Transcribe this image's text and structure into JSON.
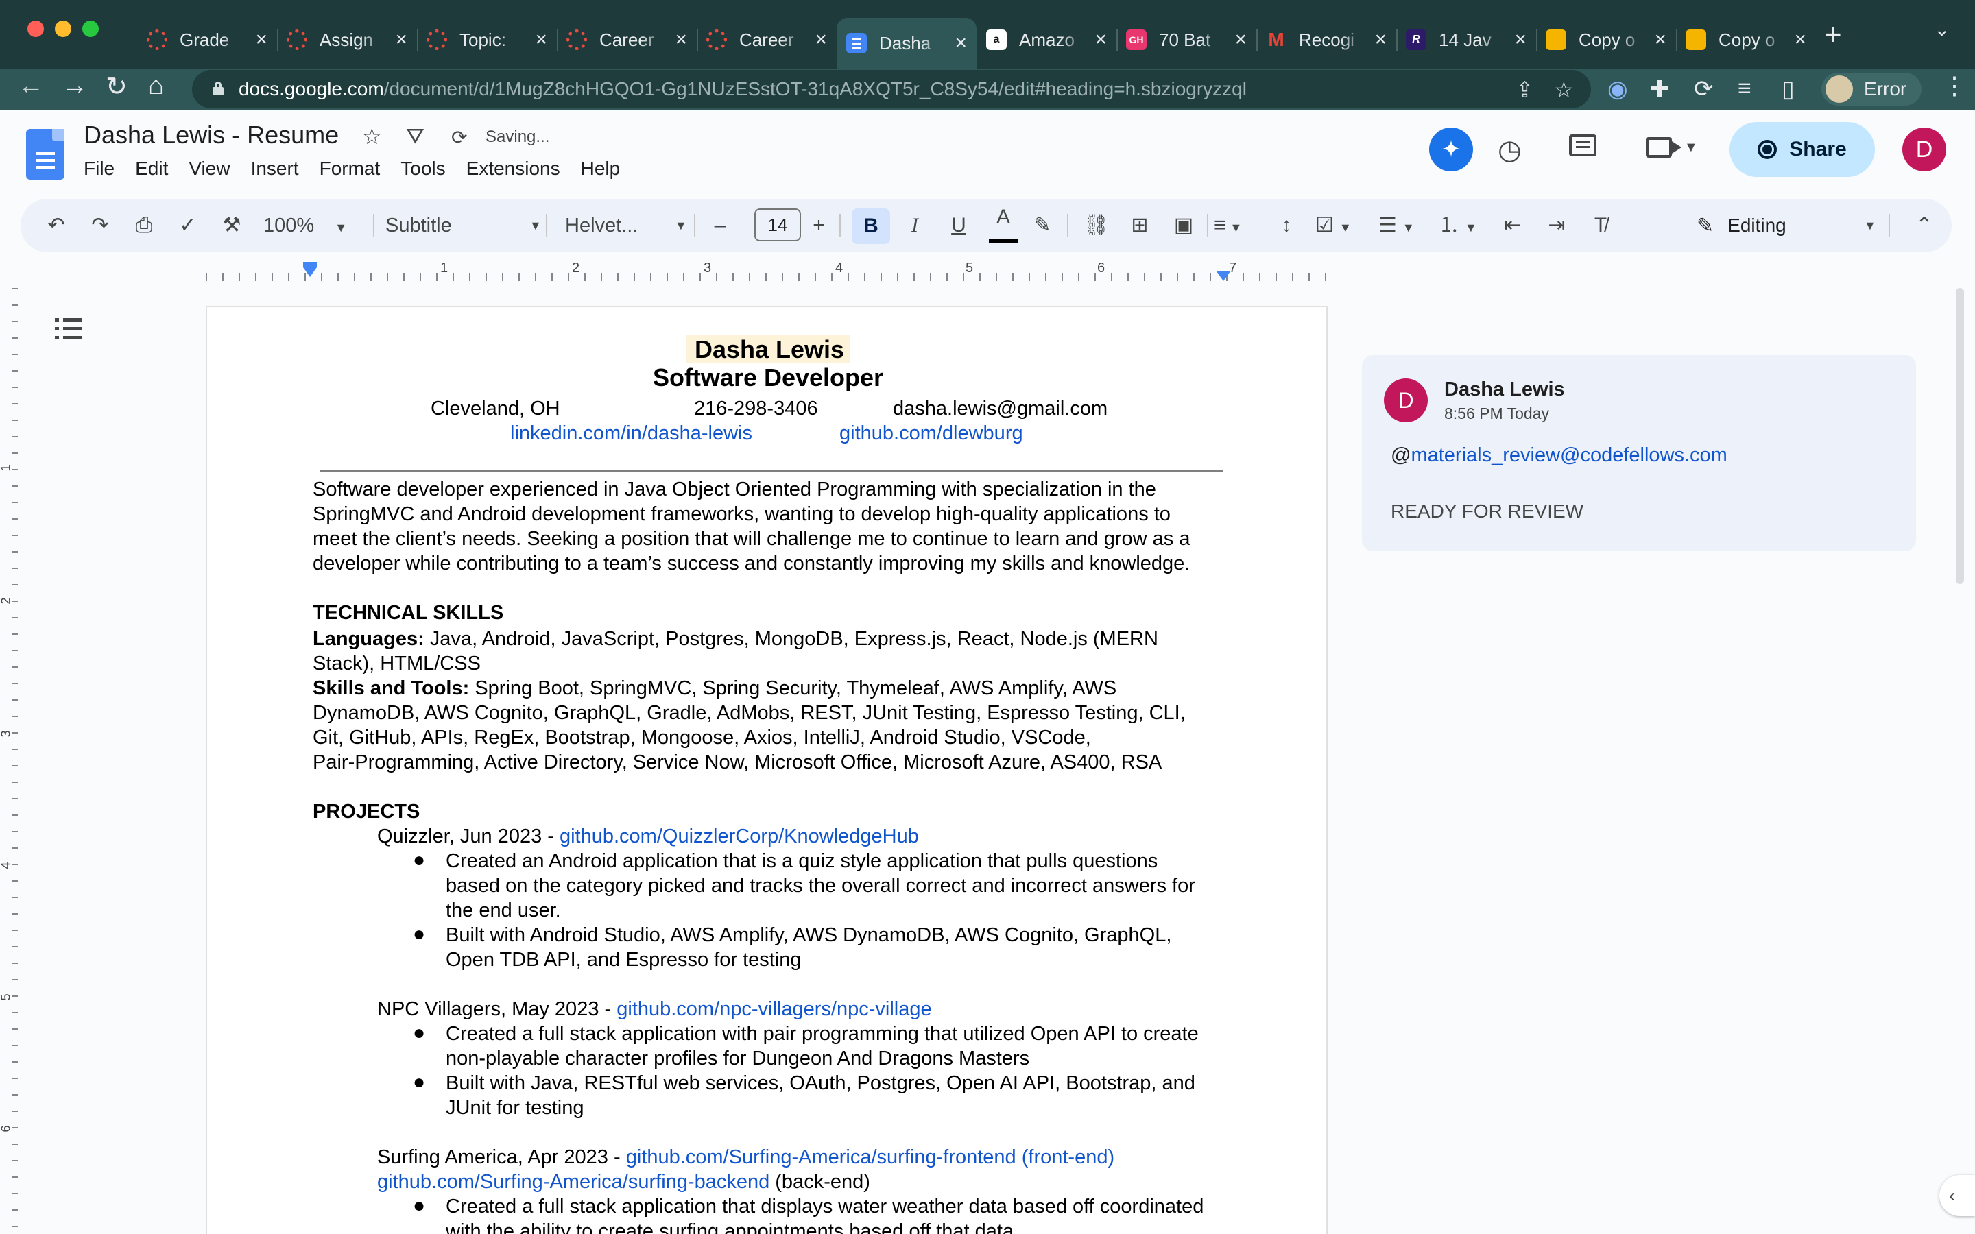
{
  "browser": {
    "tabs": [
      {
        "title": "Grade",
        "icon": "ring"
      },
      {
        "title": "Assign",
        "icon": "ring"
      },
      {
        "title": "Topic:",
        "icon": "ring"
      },
      {
        "title": "Career",
        "icon": "ring"
      },
      {
        "title": "Career",
        "icon": "ring"
      },
      {
        "title": "Dasha",
        "icon": "docs"
      },
      {
        "title": "Amazo",
        "icon": "amz"
      },
      {
        "title": "70 Bat",
        "icon": "gh"
      },
      {
        "title": "Recogi",
        "icon": "gm"
      },
      {
        "title": "14 Jav",
        "icon": "r"
      },
      {
        "title": "Copy o",
        "icon": "slides"
      },
      {
        "title": "Copy o",
        "icon": "slides"
      }
    ],
    "active_tab": 5,
    "url_host": "docs.google.com",
    "url_path": "/document/d/1MugZ8chHGQO1-Gg1NUzESstOT-31qA8XQT5r_C8Sy54/edit#heading=h.sbziogryzzql",
    "profile_label": "Error"
  },
  "docs": {
    "title": "Dasha Lewis - Resume",
    "save_status": "Saving...",
    "menu": [
      "File",
      "Edit",
      "View",
      "Insert",
      "Format",
      "Tools",
      "Extensions",
      "Help"
    ],
    "share_label": "Share",
    "avatar_letter": "D"
  },
  "toolbar": {
    "zoom": "100%",
    "style": "Subtitle",
    "font": "Helvet...",
    "font_size": "14",
    "mode": "Editing"
  },
  "ruler": {
    "labels": [
      "1",
      "2",
      "3",
      "4",
      "5",
      "6",
      "7"
    ],
    "vertical_labels": [
      "1",
      "2",
      "3",
      "4",
      "5",
      "6"
    ]
  },
  "document": {
    "name": "Dasha Lewis",
    "subtitle": "Software Developer",
    "city": "Cleveland, OH",
    "phone": "216-298-3406",
    "email": "dasha.lewis@gmail.com",
    "linkedin": "linkedin.com/in/dasha-lewis",
    "github": "github.com/dlewburg",
    "summary": [
      "Software developer experienced in Java Object Oriented Programming with specialization in the",
      "SpringMVC and Android development frameworks, wanting to develop high-quality applications to",
      "meet the client’s needs. Seeking a position that will challenge me to continue to learn and grow as a",
      "developer while contributing to a team’s success and constantly improving my skills and knowledge."
    ],
    "skills_heading": "TECHNICAL SKILLS",
    "languages_label": "Languages:",
    "languages_line1": " Java, Android, JavaScript, Postgres, MongoDB, Express.js, React, Node.js (MERN",
    "languages_line2": "Stack), HTML/CSS",
    "tools_label": "Skills and Tools:",
    "tools_line1": " Spring Boot, SpringMVC, Spring Security, Thymeleaf, AWS Amplify, AWS",
    "tools_line2": "DynamoDB, AWS Cognito, GraphQL, Gradle, AdMobs, REST, JUnit Testing, Espresso Testing, CLI,",
    "tools_line3": "Git, GitHub, APIs, RegEx, Bootstrap, Mongoose, Axios, IntelliJ, Android Studio, VSCode,",
    "tools_line4": "Pair-Programming, Active Directory, Service Now, Microsoft Office, Microsoft Azure, AS400, RSA",
    "projects_heading": "PROJECTS",
    "p1_title": "Quizzler, Jun 2023 - ",
    "p1_link": "github.com/QuizzlerCorp/KnowledgeHub",
    "p1_b1_l1": "Created an Android application that is a quiz style application that pulls questions",
    "p1_b1_l2": "based on the category picked and tracks the overall correct and incorrect answers for",
    "p1_b1_l3": "the end user.",
    "p1_b2_l1": "Built with Android Studio, AWS Amplify, AWS DynamoDB, AWS Cognito, GraphQL,",
    "p1_b2_l2": "Open TDB API, and Espresso for testing",
    "p2_title": "NPC Villagers, May 2023 - ",
    "p2_link": "github.com/npc-villagers/npc-village",
    "p2_b1_l1": "Created a full stack application with pair programming that utilized Open API to create",
    "p2_b1_l2": "non-playable character profiles for Dungeon And Dragons Masters",
    "p2_b2_l1": "Built with Java, RESTful web services, OAuth, Postgres, Open AI API, Bootstrap, and",
    "p2_b2_l2": "JUnit for testing",
    "p3_title": "Surfing America, Apr 2023 - ",
    "p3_link1": "github.com/Surfing-America/surfing-frontend (front-end)",
    "p3_link2": "github.com/Surfing-America/surfing-backend",
    "p3_link2_suffix": " (back-end)",
    "p3_b1_l1": "Created a full stack application that displays water weather data based off coordinated",
    "p3_b1_l2": "with the ability to create surfing appointments based off that data",
    "bullet_char": "●"
  },
  "comment": {
    "author": "Dasha Lewis",
    "time": "8:56 PM Today",
    "mention_prefix": "@",
    "mention": "materials_review@codefellows.com",
    "body": "READY FOR REVIEW",
    "avatar_letter": "D"
  },
  "colors": {
    "link": "#1155cc",
    "share_bg": "#c2e7ff",
    "avatar": "#c2185b",
    "tabstrip": "#1e3a3a"
  }
}
